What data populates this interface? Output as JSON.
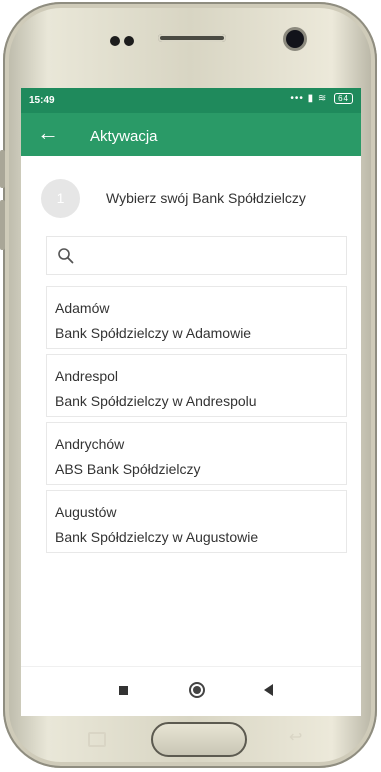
{
  "status_bar": {
    "time": "15:49",
    "icons": "... ",
    "battery": "64"
  },
  "app_bar": {
    "title": "Aktywacja",
    "back_icon": "arrow-left-icon"
  },
  "step": {
    "number": "1",
    "label": "Wybierz swój Bank Spółdzielczy"
  },
  "search": {
    "value": "",
    "placeholder": "",
    "icon": "search-icon"
  },
  "banks": [
    {
      "city": "Adamów",
      "name": "Bank Spółdzielczy w Adamowie"
    },
    {
      "city": "Andrespol",
      "name": "Bank Spółdzielczy w Andrespolu"
    },
    {
      "city": "Andrychów",
      "name": "ABS Bank Spółdzielczy"
    },
    {
      "city": "Augustów",
      "name": "Bank Spółdzielczy w Augustowie"
    }
  ],
  "colors": {
    "status_bar": "#1f8a5c",
    "app_bar": "#2a9a67",
    "step_circle": "#e6e6e6"
  }
}
